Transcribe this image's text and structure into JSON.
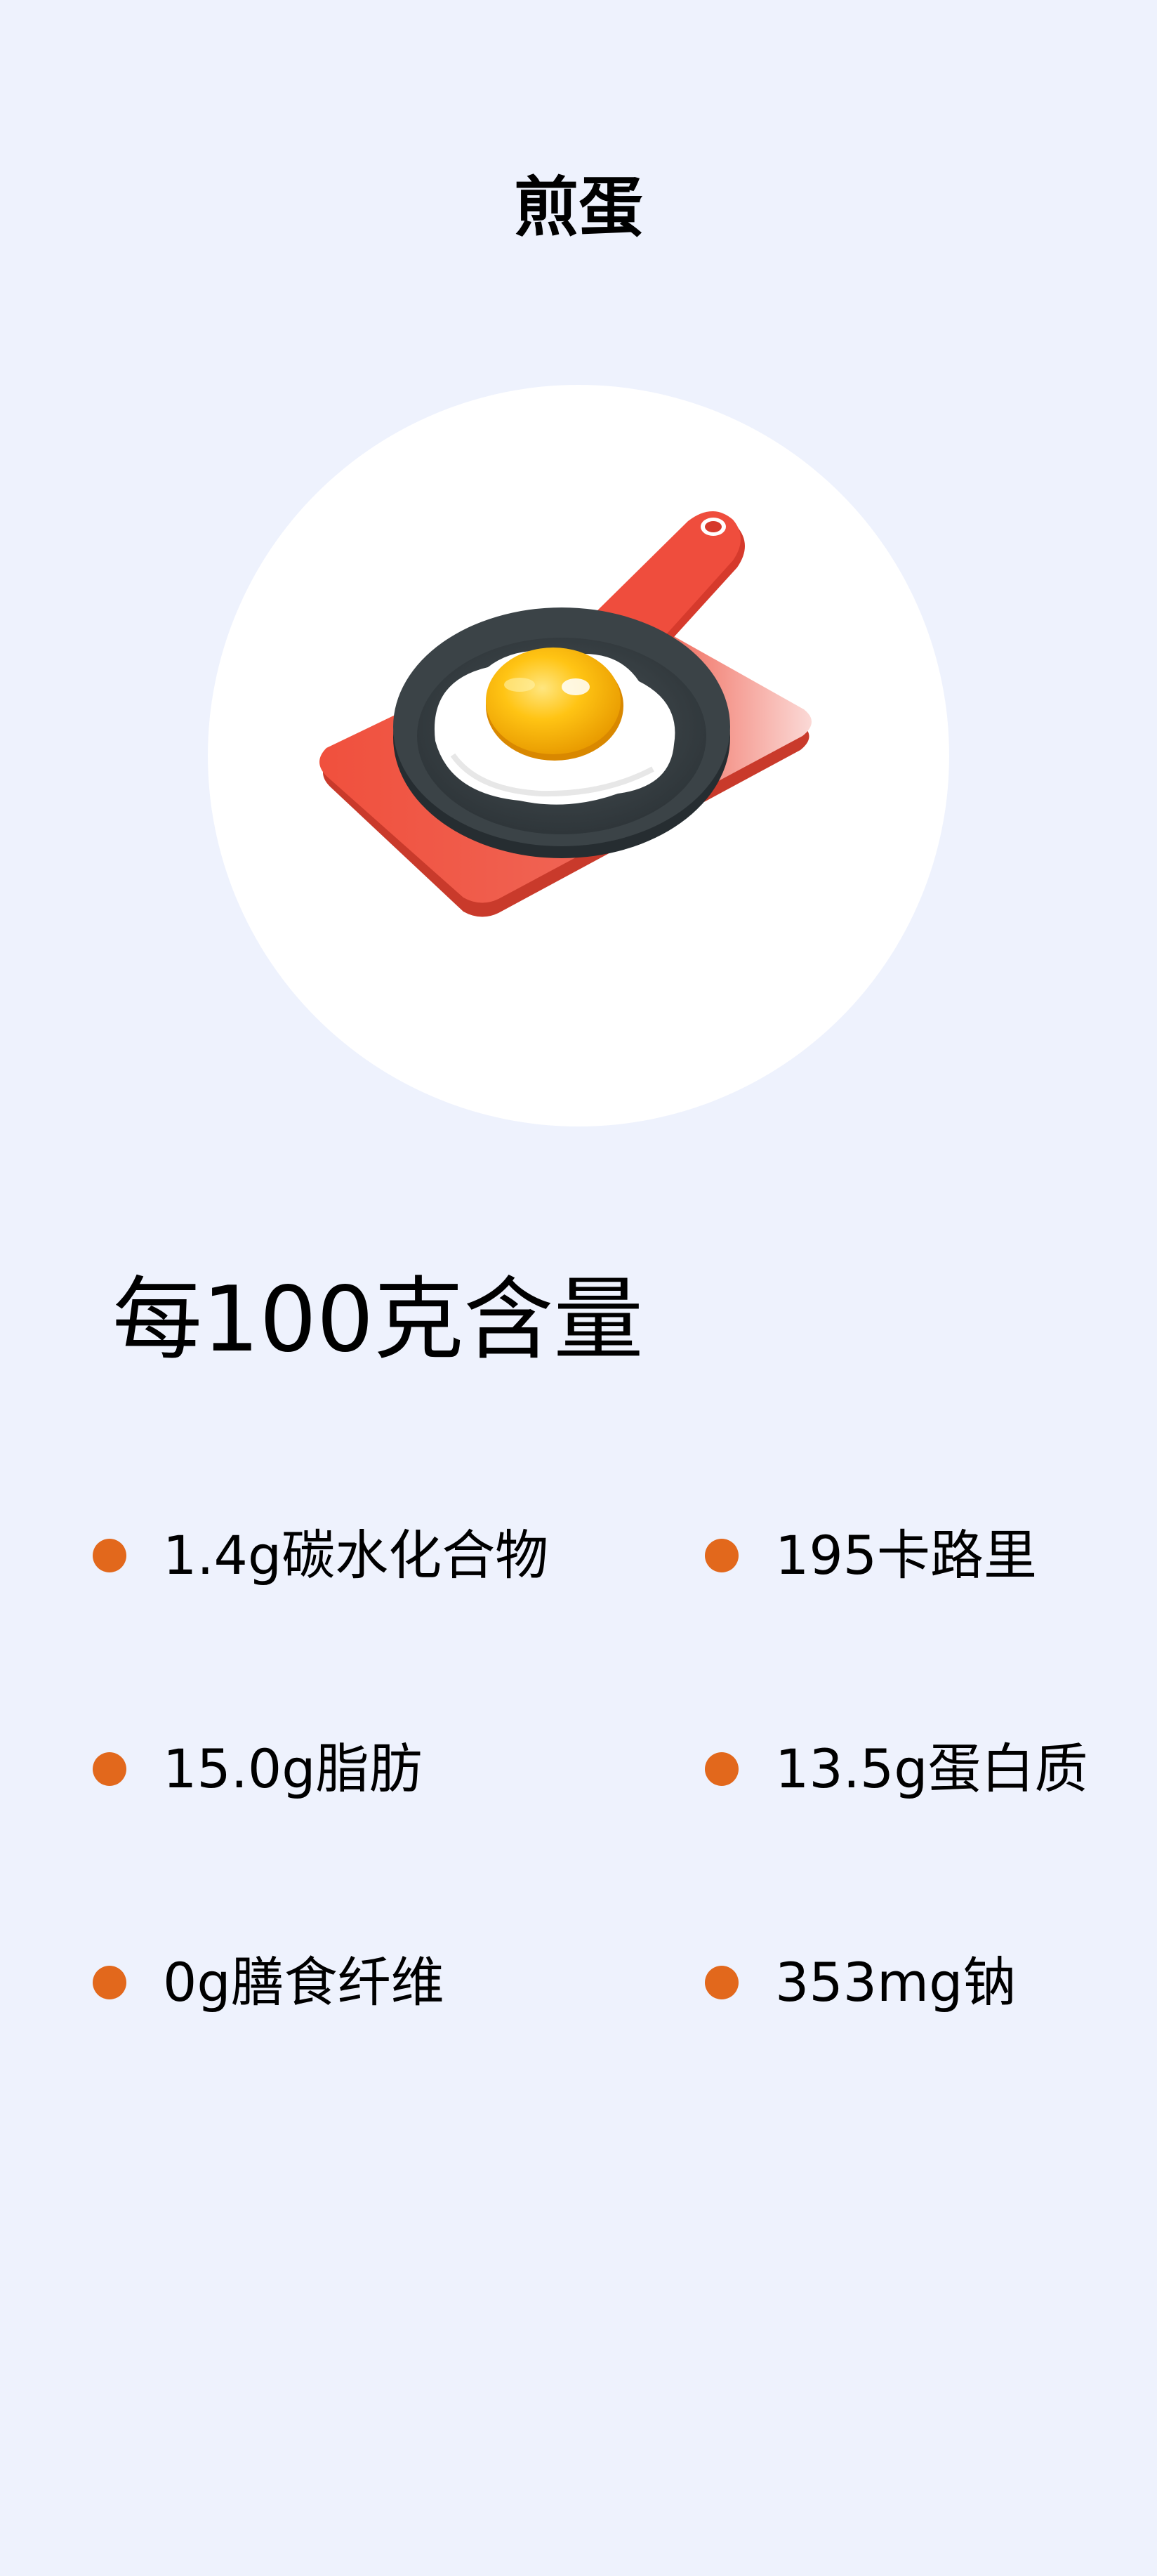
{
  "header": {
    "title": "煎蛋"
  },
  "hero": {
    "icon": "fried-egg-in-pan-icon",
    "colors": {
      "board": "#ee4a38",
      "pan": "#3b4347",
      "egg_white": "#ffffff",
      "yolk": "#f8b400"
    }
  },
  "nutrition": {
    "heading": "每100克含量",
    "bullet_color": "#e2681c",
    "items": [
      {
        "label": "1.4g碳水化合物"
      },
      {
        "label": "195卡路里"
      },
      {
        "label": "15.0g脂肪"
      },
      {
        "label": "13.5g蛋白质"
      },
      {
        "label": "0g膳食纤维"
      },
      {
        "label": "353mg钠"
      }
    ]
  }
}
